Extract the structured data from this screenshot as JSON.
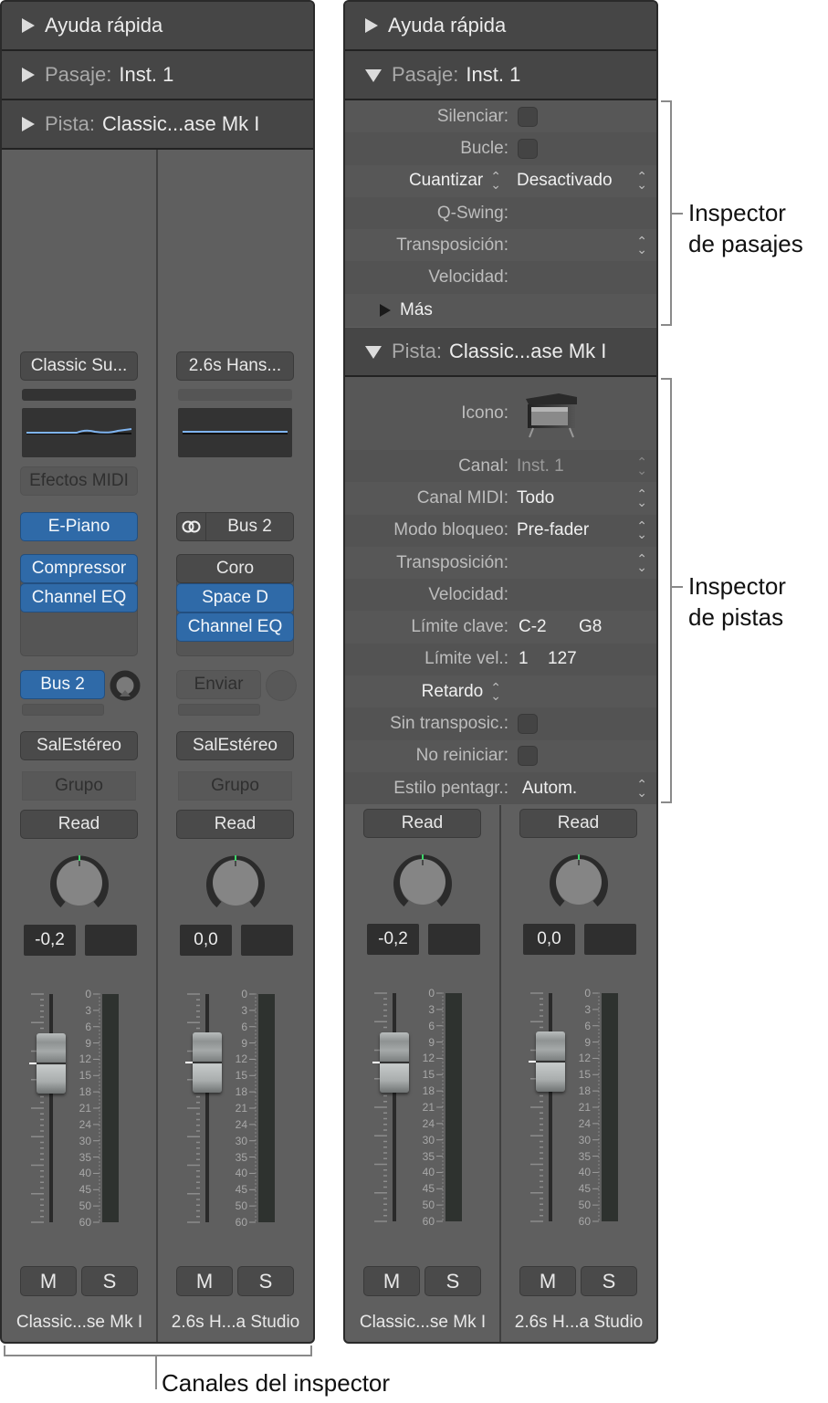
{
  "left_panel": {
    "headers": [
      {
        "state": "collapsed",
        "label": "",
        "value": "Ayuda rápida"
      },
      {
        "state": "collapsed",
        "label": "Pasaje:",
        "value": "Inst. 1"
      },
      {
        "state": "collapsed",
        "label": "Pista:",
        "value": "Classic...ase Mk I"
      }
    ]
  },
  "right_panel": {
    "headers": [
      {
        "state": "collapsed",
        "label": "",
        "value": "Ayuda rápida"
      },
      {
        "state": "expanded",
        "label": "Pasaje:",
        "value": "Inst. 1"
      },
      {
        "state": "expanded",
        "label": "Pista:",
        "value": "Classic...ase Mk I"
      }
    ],
    "region_inspector": {
      "rows": [
        {
          "label": "Silenciar:",
          "type": "checkbox",
          "checked": false
        },
        {
          "label": "Bucle:",
          "type": "checkbox",
          "checked": false
        },
        {
          "label": "Cuantizar",
          "type": "popup",
          "value": "Desactivado"
        },
        {
          "label": "Q-Swing:",
          "type": "value",
          "value": ""
        },
        {
          "label": "Transposición:",
          "type": "stepper",
          "value": ""
        },
        {
          "label": "Velocidad:",
          "type": "value",
          "value": ""
        }
      ],
      "more_label": "Más"
    },
    "track_inspector": {
      "icon_label": "Icono:",
      "icon": "electric-piano-icon",
      "rows": [
        {
          "label": "Canal:",
          "type": "popup-disabled",
          "value": "Inst. 1"
        },
        {
          "label": "Canal MIDI:",
          "type": "popup",
          "value": "Todo"
        },
        {
          "label": "Modo bloqueo:",
          "type": "popup",
          "value": "Pre-fader"
        },
        {
          "label": "Transposición:",
          "type": "stepper",
          "value": ""
        },
        {
          "label": "Velocidad:",
          "type": "value",
          "value": ""
        },
        {
          "label": "Límite clave:",
          "type": "range",
          "low": "C-2",
          "high": "G8"
        },
        {
          "label": "Límite vel.:",
          "type": "range",
          "low": "1",
          "high": "127"
        },
        {
          "label": "Retardo",
          "type": "popup-label",
          "value": ""
        },
        {
          "label": "Sin transposic.:",
          "type": "checkbox",
          "checked": false
        },
        {
          "label": "No reiniciar:",
          "type": "checkbox",
          "checked": false
        },
        {
          "label": "Estilo pentagr.:",
          "type": "popup",
          "value": "Autom."
        }
      ]
    }
  },
  "channel_strips": [
    {
      "id": "inst",
      "setting": "Classic Su...",
      "midi_fx": "Efectos MIDI",
      "instrument": "E-Piano",
      "instrument_linked": false,
      "effects": [
        {
          "name": "Compressor",
          "active": true
        },
        {
          "name": "Channel EQ",
          "active": true
        }
      ],
      "send": {
        "label": "Bus 2",
        "active": true,
        "level": 0.85
      },
      "output": "SalEstéreo",
      "group": "Grupo",
      "automation": "Read",
      "pan": 0,
      "volume": "-0,2",
      "peak": "",
      "fader_db": -0.2,
      "mute": "M",
      "solo": "S",
      "name": "Classic...se Mk I"
    },
    {
      "id": "aux",
      "setting": "2.6s Hans...",
      "midi_fx": "",
      "instrument": "Bus 2",
      "instrument_linked": true,
      "effects": [
        {
          "name": "Coro",
          "active": false
        },
        {
          "name": "Space D",
          "active": true
        },
        {
          "name": "Channel EQ",
          "active": true
        }
      ],
      "send": {
        "label": "Enviar",
        "active": false,
        "level": 0
      },
      "output": "SalEstéreo",
      "group": "Grupo",
      "automation": "Read",
      "pan": 0,
      "volume": "0,0",
      "peak": "",
      "fader_db": 0.0,
      "mute": "M",
      "solo": "S",
      "name": "2.6s H...a Studio"
    }
  ],
  "meter_scale": [
    "0",
    "3",
    "6",
    "9",
    "12",
    "15",
    "18",
    "21",
    "24",
    "30",
    "35",
    "40",
    "45",
    "50",
    "60"
  ],
  "annotations": {
    "region_inspector": "Inspector\nde pasajes",
    "track_inspector": "Inspector\nde pistas",
    "inspector_channels": "Canales del inspector"
  },
  "colors": {
    "panel_bg": "#5f5f5f",
    "header_bg": "#464646",
    "active_blue": "#2f6aa8",
    "pan_indicator": "#3fd46a",
    "eq_curve": "#7fb4f0"
  }
}
